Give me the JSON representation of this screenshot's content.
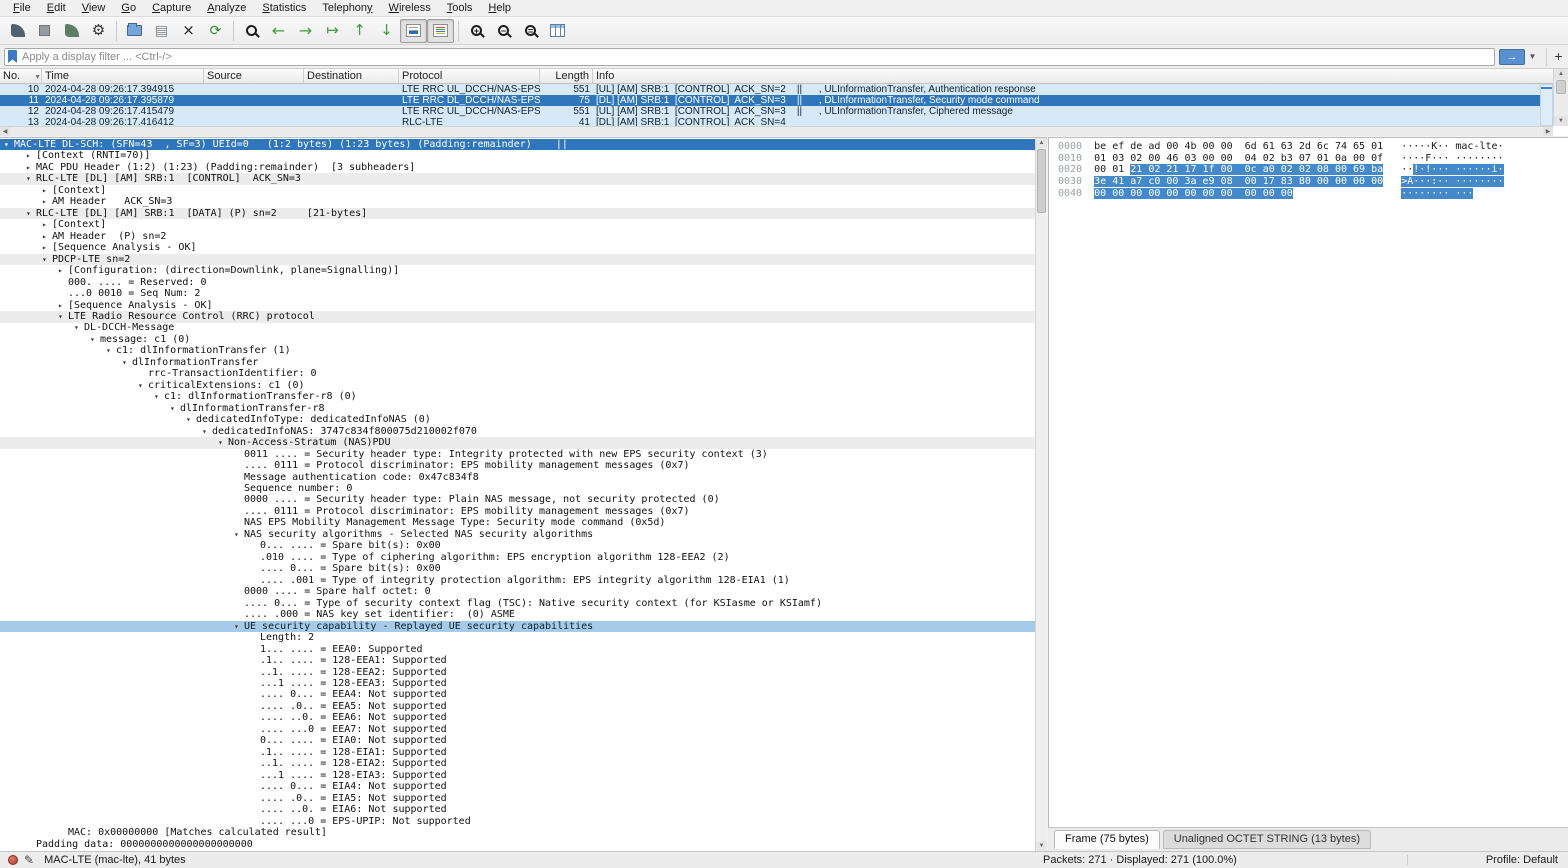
{
  "menu": {
    "items": [
      {
        "label": "File",
        "u": 0
      },
      {
        "label": "Edit",
        "u": 0
      },
      {
        "label": "View",
        "u": 0
      },
      {
        "label": "Go",
        "u": 0
      },
      {
        "label": "Capture",
        "u": 0
      },
      {
        "label": "Analyze",
        "u": 0
      },
      {
        "label": "Statistics",
        "u": 0
      },
      {
        "label": "Telephony",
        "u": 8
      },
      {
        "label": "Wireless",
        "u": 0
      },
      {
        "label": "Tools",
        "u": 0
      },
      {
        "label": "Help",
        "u": 0
      }
    ]
  },
  "toolbar": {
    "icons": [
      {
        "name": "start-capture-icon",
        "kind": "fin"
      },
      {
        "name": "stop-capture-icon",
        "kind": "square"
      },
      {
        "name": "restart-capture-icon",
        "kind": "fin-green"
      },
      {
        "name": "capture-options-icon",
        "kind": "glyph",
        "glyph": "⚙",
        "color": "#2f3337",
        "size": 15
      },
      {
        "name": "sep"
      },
      {
        "name": "open-file-icon",
        "kind": "folder"
      },
      {
        "name": "save-file-icon",
        "kind": "glyph",
        "glyph": "▤",
        "color": "#7d838a",
        "size": 14
      },
      {
        "name": "close-file-icon",
        "kind": "glyph",
        "glyph": "×",
        "color": "#1f1f1f",
        "size": 15
      },
      {
        "name": "reload-file-icon",
        "kind": "glyph",
        "glyph": "⟳",
        "color": "#2e8b2e",
        "size": 14
      },
      {
        "name": "sep"
      },
      {
        "name": "find-packet-icon",
        "kind": "mag",
        "sign": ""
      },
      {
        "name": "go-back-icon",
        "kind": "glyph",
        "glyph": "←",
        "color": "#3f9d3f",
        "size": 16
      },
      {
        "name": "go-forward-icon",
        "kind": "glyph",
        "glyph": "→",
        "color": "#3f9d3f",
        "size": 16
      },
      {
        "name": "go-to-packet-icon",
        "kind": "glyph",
        "glyph": "↦",
        "color": "#3f9d3f",
        "size": 15
      },
      {
        "name": "go-first-icon",
        "kind": "glyph",
        "glyph": "↑",
        "color": "#3f9d3f",
        "size": 15
      },
      {
        "name": "go-last-icon",
        "kind": "glyph",
        "glyph": "↓",
        "color": "#3f9d3f",
        "size": 15
      },
      {
        "name": "auto-scroll-icon",
        "kind": "scroll",
        "pressed": true
      },
      {
        "name": "colorize-icon",
        "kind": "colors",
        "pressed": true
      },
      {
        "name": "sep"
      },
      {
        "name": "zoom-in-icon",
        "kind": "mag",
        "sign": "+"
      },
      {
        "name": "zoom-out-icon",
        "kind": "mag",
        "sign": "−"
      },
      {
        "name": "zoom-original-icon",
        "kind": "mag",
        "sign": "="
      },
      {
        "name": "resize-columns-icon",
        "kind": "coltable"
      }
    ]
  },
  "filter": {
    "placeholder": "Apply a display filter ... <Ctrl-/>",
    "apply_label": "→",
    "dropdown_label": "▼",
    "add_label": "+"
  },
  "packet_list": {
    "columns": [
      "No.",
      "Time",
      "Source",
      "Destination",
      "Protocol",
      "Length",
      "Info"
    ],
    "sort_indicator": "▼",
    "rows": [
      {
        "no": "10",
        "time": "2024-04-28 09:26:17.394915",
        "source": "",
        "destination": "",
        "protocol": "LTE RRC UL_DCCH/NAS-EPS",
        "length": "551",
        "info": "[UL] [AM] SRB:1  [CONTROL]  ACK_SN=2    ||      , ULInformationTransfer, Authentication response",
        "state": "blue"
      },
      {
        "no": "11",
        "time": "2024-04-28 09:26:17.395879",
        "source": "",
        "destination": "",
        "protocol": "LTE RRC DL_DCCH/NAS-EPS",
        "length": "75",
        "info": "[DL] [AM] SRB:1  [CONTROL]  ACK_SN=3    ||      , DLInformationTransfer, Security mode command",
        "state": "sel"
      },
      {
        "no": "12",
        "time": "2024-04-28 09:26:17.415479",
        "source": "",
        "destination": "",
        "protocol": "LTE RRC UL_DCCH/NAS-EPS",
        "length": "551",
        "info": "[UL] [AM] SRB:1  [CONTROL]  ACK_SN=3    ||      , ULInformationTransfer, Ciphered message",
        "state": "blue"
      },
      {
        "no": "13",
        "time": "2024-04-28 09:26:17.416412",
        "source": "",
        "destination": "",
        "protocol": "RLC-LTE",
        "length": "41",
        "info": "[DL] [AM] SRB:1  [CONTROL]  ACK_SN=4",
        "state": "blue"
      }
    ]
  },
  "detail_tree": {
    "rows": [
      {
        "level": 0,
        "exp": "open",
        "text": "MAC-LTE DL-SCH: (SFN=43  , SF=3) UEId=0   (1:2 bytes) (1:23 bytes) (Padding:remainder)    ||",
        "state": "sel"
      },
      {
        "level": 1,
        "exp": "closed",
        "text": "[Context (RNTI=70)]"
      },
      {
        "level": 1,
        "exp": "closed",
        "text": "MAC PDU Header (1:2) (1:23) (Padding:remainder)  [3 subheaders]"
      },
      {
        "level": 1,
        "exp": "open",
        "text": "RLC-LTE [DL] [AM] SRB:1  [CONTROL]  ACK_SN=3",
        "state": "proto"
      },
      {
        "level": 2,
        "exp": "closed",
        "text": "[Context]"
      },
      {
        "level": 2,
        "exp": "closed",
        "text": "AM Header   ACK_SN=3"
      },
      {
        "level": 1,
        "exp": "open",
        "text": "RLC-LTE [DL] [AM] SRB:1  [DATA] (P) sn=2     [21-bytes]",
        "state": "proto"
      },
      {
        "level": 2,
        "exp": "closed",
        "text": "[Context]"
      },
      {
        "level": 2,
        "exp": "closed",
        "text": "AM Header  (P) sn=2"
      },
      {
        "level": 2,
        "exp": "closed",
        "text": "[Sequence Analysis - OK]"
      },
      {
        "level": 2,
        "exp": "open",
        "text": "PDCP-LTE sn=2",
        "state": "proto"
      },
      {
        "level": 3,
        "exp": "closed",
        "text": "[Configuration: (direction=Downlink, plane=Signalling)]"
      },
      {
        "level": 3,
        "exp": "none",
        "text": "000. .... = Reserved: 0"
      },
      {
        "level": 3,
        "exp": "none",
        "text": "...0 0010 = Seq Num: 2"
      },
      {
        "level": 3,
        "exp": "closed",
        "text": "[Sequence Analysis - OK]"
      },
      {
        "level": 3,
        "exp": "open",
        "text": "LTE Radio Resource Control (RRC) protocol",
        "state": "proto"
      },
      {
        "level": 4,
        "exp": "open",
        "text": "DL-DCCH-Message"
      },
      {
        "level": 5,
        "exp": "open",
        "text": "message: c1 (0)"
      },
      {
        "level": 6,
        "exp": "open",
        "text": "c1: dlInformationTransfer (1)"
      },
      {
        "level": 7,
        "exp": "open",
        "text": "dlInformationTransfer"
      },
      {
        "level": 8,
        "exp": "none",
        "text": "rrc-TransactionIdentifier: 0"
      },
      {
        "level": 8,
        "exp": "open",
        "text": "criticalExtensions: c1 (0)"
      },
      {
        "level": 9,
        "exp": "open",
        "text": "c1: dlInformationTransfer-r8 (0)"
      },
      {
        "level": 10,
        "exp": "open",
        "text": "dlInformationTransfer-r8"
      },
      {
        "level": 11,
        "exp": "open",
        "text": "dedicatedInfoType: dedicatedInfoNAS (0)"
      },
      {
        "level": 12,
        "exp": "open",
        "text": "dedicatedInfoNAS: 3747c834f800075d210002f070"
      },
      {
        "level": 13,
        "exp": "open",
        "text": "Non-Access-Stratum (NAS)PDU",
        "state": "proto"
      },
      {
        "level": 14,
        "exp": "none",
        "text": "0011 .... = Security header type: Integrity protected with new EPS security context (3)"
      },
      {
        "level": 14,
        "exp": "none",
        "text": ".... 0111 = Protocol discriminator: EPS mobility management messages (0x7)"
      },
      {
        "level": 14,
        "exp": "none",
        "text": "Message authentication code: 0x47c834f8"
      },
      {
        "level": 14,
        "exp": "none",
        "text": "Sequence number: 0"
      },
      {
        "level": 14,
        "exp": "none",
        "text": "0000 .... = Security header type: Plain NAS message, not security protected (0)"
      },
      {
        "level": 14,
        "exp": "none",
        "text": ".... 0111 = Protocol discriminator: EPS mobility management messages (0x7)"
      },
      {
        "level": 14,
        "exp": "none",
        "text": "NAS EPS Mobility Management Message Type: Security mode command (0x5d)"
      },
      {
        "level": 14,
        "exp": "open",
        "text": "NAS security algorithms - Selected NAS security algorithms"
      },
      {
        "level": 15,
        "exp": "none",
        "text": "0... .... = Spare bit(s): 0x00"
      },
      {
        "level": 15,
        "exp": "none",
        "text": ".010 .... = Type of ciphering algorithm: EPS encryption algorithm 128-EEA2 (2)"
      },
      {
        "level": 15,
        "exp": "none",
        "text": ".... 0... = Spare bit(s): 0x00"
      },
      {
        "level": 15,
        "exp": "none",
        "text": ".... .001 = Type of integrity protection algorithm: EPS integrity algorithm 128-EIA1 (1)"
      },
      {
        "level": 14,
        "exp": "none",
        "text": "0000 .... = Spare half octet: 0"
      },
      {
        "level": 14,
        "exp": "none",
        "text": ".... 0... = Type of security context flag (TSC): Native security context (for KSIasme or KSIamf)"
      },
      {
        "level": 14,
        "exp": "none",
        "text": ".... .000 = NAS key set identifier:  (0) ASME"
      },
      {
        "level": 14,
        "exp": "open",
        "text": "UE security capability - Replayed UE security capabilities",
        "state": "hl"
      },
      {
        "level": 15,
        "exp": "none",
        "text": "Length: 2"
      },
      {
        "level": 15,
        "exp": "none",
        "text": "1... .... = EEA0: Supported"
      },
      {
        "level": 15,
        "exp": "none",
        "text": ".1.. .... = 128-EEA1: Supported"
      },
      {
        "level": 15,
        "exp": "none",
        "text": "..1. .... = 128-EEA2: Supported"
      },
      {
        "level": 15,
        "exp": "none",
        "text": "...1 .... = 128-EEA3: Supported"
      },
      {
        "level": 15,
        "exp": "none",
        "text": ".... 0... = EEA4: Not supported"
      },
      {
        "level": 15,
        "exp": "none",
        "text": ".... .0.. = EEA5: Not supported"
      },
      {
        "level": 15,
        "exp": "none",
        "text": ".... ..0. = EEA6: Not supported"
      },
      {
        "level": 15,
        "exp": "none",
        "text": ".... ...0 = EEA7: Not supported"
      },
      {
        "level": 15,
        "exp": "none",
        "text": "0... .... = EIA0: Not supported"
      },
      {
        "level": 15,
        "exp": "none",
        "text": ".1.. .... = 128-EIA1: Supported"
      },
      {
        "level": 15,
        "exp": "none",
        "text": "..1. .... = 128-EIA2: Supported"
      },
      {
        "level": 15,
        "exp": "none",
        "text": "...1 .... = 128-EIA3: Supported"
      },
      {
        "level": 15,
        "exp": "none",
        "text": ".... 0... = EIA4: Not supported"
      },
      {
        "level": 15,
        "exp": "none",
        "text": ".... .0.. = EIA5: Not supported"
      },
      {
        "level": 15,
        "exp": "none",
        "text": ".... ..0. = EIA6: Not supported"
      },
      {
        "level": 15,
        "exp": "none",
        "text": ".... ...0 = EPS-UPIP: Not supported"
      },
      {
        "level": 3,
        "exp": "none",
        "text": "MAC: 0x00000000 [Matches calculated result]"
      },
      {
        "level": 1,
        "exp": "none",
        "text": "Padding data: 0000000000000000000000"
      }
    ]
  },
  "hex_view": {
    "rows": [
      {
        "offset": "0000",
        "bytes": [
          "be",
          "ef",
          "de",
          "ad",
          "00",
          "4b",
          "00",
          "00",
          "6d",
          "61",
          "63",
          "2d",
          "6c",
          "74",
          "65",
          "01"
        ],
        "ascii": "·····K··mac-lte·",
        "hl_from": -1
      },
      {
        "offset": "0010",
        "bytes": [
          "01",
          "03",
          "02",
          "00",
          "46",
          "03",
          "00",
          "00",
          "04",
          "02",
          "b3",
          "07",
          "01",
          "0a",
          "00",
          "0f"
        ],
        "ascii": "····F···········",
        "hl_from": -1
      },
      {
        "offset": "0020",
        "bytes": [
          "00",
          "01",
          "21",
          "02",
          "21",
          "17",
          "1f",
          "00",
          "0c",
          "a0",
          "02",
          "02",
          "08",
          "00",
          "69",
          "ba"
        ],
        "ascii": "··!·!·········i·",
        "hl_from": 2
      },
      {
        "offset": "0030",
        "bytes": [
          "3e",
          "41",
          "a7",
          "c0",
          "00",
          "3a",
          "e9",
          "08",
          "00",
          "17",
          "83",
          "80",
          "00",
          "00",
          "00",
          "00"
        ],
        "ascii": ">A···:··········",
        "hl_from": 0
      },
      {
        "offset": "0040",
        "bytes": [
          "00",
          "00",
          "00",
          "00",
          "00",
          "00",
          "00",
          "00",
          "00",
          "00",
          "00"
        ],
        "ascii": "···········",
        "hl_from": 0
      }
    ]
  },
  "byte_tabs": [
    {
      "label": "Frame (75 bytes)",
      "active": true
    },
    {
      "label": "Unaligned OCTET STRING (13 bytes)",
      "active": false
    }
  ],
  "status_bar": {
    "left_text": "MAC-LTE (mac-lte), 41 bytes",
    "packets_text": "Packets: 271 · Displayed: 271 (100.0%)",
    "profile_text": "Profile: Default"
  },
  "colors": {
    "selection_blue": "#2f76bc",
    "packet_row_blue": "#d7e8f7",
    "field_highlight_blue": "#a5cbe9",
    "hex_highlight_blue": "#4489cb",
    "expert_red": "#b03a30"
  }
}
